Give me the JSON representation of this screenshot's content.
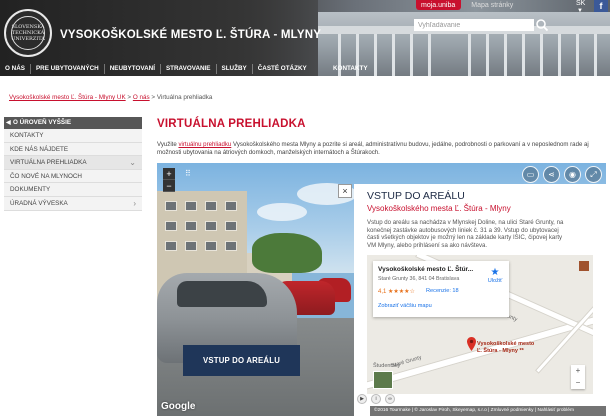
{
  "header": {
    "logo_text": "SLOVENSKÁ TECHNICKÁ UNIVERZITA",
    "site_title": "VYSOKOŠKOLSKÉ MESTO Ľ. ŠTÚRA - MLYNY",
    "moja_uniba": "moja.uniba",
    "mapa_stranky": "Mapa stránky",
    "lang": "SK",
    "fb": "f",
    "search_placeholder": "Vyhľadávanie",
    "nav": [
      "O NÁS",
      "PRE UBYTOVANÝCH",
      "NEUBYTOVANÍ",
      "STRAVOVANIE",
      "SLUŽBY",
      "ČASTÉ OTÁZKY"
    ],
    "nav_right": "KONTAKTY"
  },
  "breadcrumb": {
    "items": [
      "Vysokoškolské mesto Ľ. Štúra - Mlyny UK",
      "O nás"
    ],
    "sep": ">",
    "current": "Virtuálna prehliadka"
  },
  "sidebar": {
    "back_label": "O ÚROVEŇ VYŠŠIE",
    "items": [
      {
        "label": "KONTAKTY"
      },
      {
        "label": "KDE NÁS NÁJDETE"
      },
      {
        "label": "VIRTUÁLNA PREHLIADKA"
      },
      {
        "label": "ČO NOVÉ NA MLYNOCH"
      },
      {
        "label": "DOKUMENTY"
      },
      {
        "label": "ÚRADNÁ VÝVESKA"
      }
    ]
  },
  "main": {
    "title": "VIRTUÁLNA PREHLIADKA",
    "intro_pre": "Využite ",
    "intro_link": "virtuálnu prehliadku",
    "intro_post": " Vysokoškolského mesta Mlyny a pozrite si areál, administratívnu budovu, jedálne, podrobnosti o parkovaní a v neposlednom rade aj možnosti ubytovania na átriových domkoch, manželských internátoch a Štúrakoch."
  },
  "viewer": {
    "zoom_in": "+",
    "zoom_out": "−",
    "cta": "VSTUP DO AREÁLU",
    "google": "Google",
    "close": "×",
    "panel": {
      "title": "VSTUP DO AREÁLU",
      "subtitle": "Vysokoškolského mesta Ľ. Štúra - Mlyny",
      "desc": "Vstup do areálu sa nachádza v Mlynskej Doline, na ulici Staré Grunty, na konečnej zastávke autobusových liniek č. 31 a 39. Vstup do ubytovacej časti všetkých objektov je možný len na základe karty ISIC, čipovej karty VM Mlyny, alebo prihlásení sa ako návšteva."
    },
    "map": {
      "card_title": "Vysokoškolské mesto Ľ. Štúr...",
      "card_addr": "Staré Grunty 36, 841 04 Bratislava",
      "rating": "4,1",
      "stars": "★★★★☆",
      "reviews": "Recenzie: 18",
      "link": "Zobraziť väčšiu mapu",
      "save": "Uložiť",
      "pin_label_1": "Vysokoškolské mesto",
      "pin_label_2": "Ľ. Štúra - Mlyny **",
      "street_1": "Staré Grunty",
      "street_2": "Staré Grunty",
      "place": "Študentský",
      "zoom_in": "+",
      "zoom_out": "−"
    },
    "credits": "©2016 Tourmake  |  © Jaroslav Piroh, Skeyemap, s.r.o  |  Zmluvné podmienky  |  Nahlásiť problém"
  },
  "colors": {
    "accent": "#c8102e",
    "navy": "#1f3659",
    "sidebar_head": "#575757"
  }
}
